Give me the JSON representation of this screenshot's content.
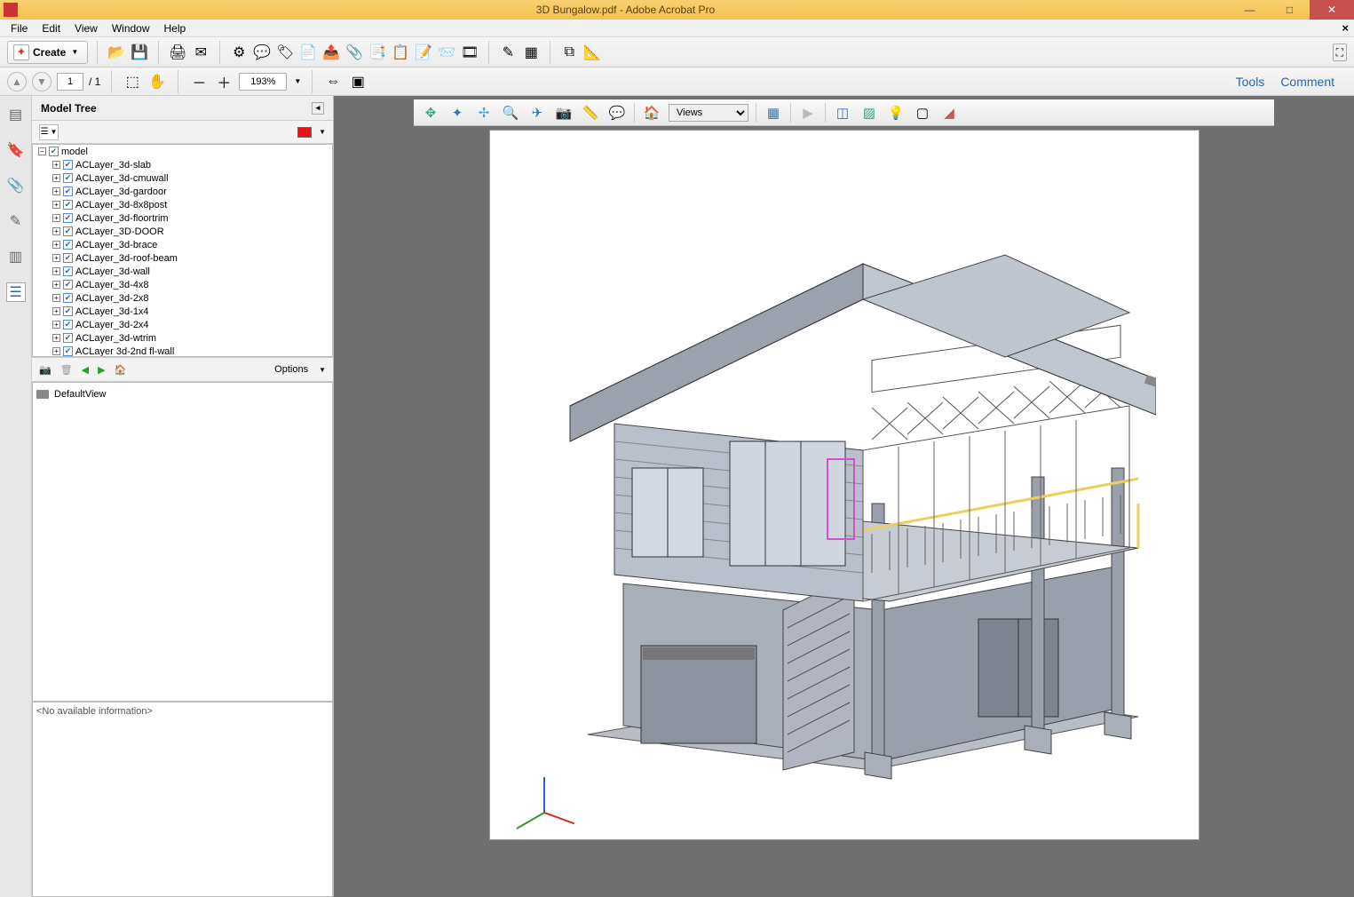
{
  "window": {
    "title": "3D Bungalow.pdf - Adobe Acrobat Pro"
  },
  "menubar": {
    "items": [
      "File",
      "Edit",
      "View",
      "Window",
      "Help"
    ]
  },
  "main_toolbar": {
    "create_label": "Create"
  },
  "nav": {
    "page_current": "1",
    "page_total": "/ 1",
    "zoom": "193%",
    "tools_label": "Tools",
    "comment_label": "Comment"
  },
  "panel": {
    "title": "Model Tree",
    "options_label": "Options",
    "info_placeholder": "<No available information>",
    "default_view_label": "DefaultView"
  },
  "tree": {
    "root": "model",
    "items": [
      "ACLayer_3d-slab",
      "ACLayer_3d-cmuwall",
      "ACLayer_3d-gardoor",
      "ACLayer_3d-8x8post",
      "ACLayer_3d-floortrim",
      "ACLayer_3D-DOOR",
      "ACLayer_3d-brace",
      "ACLayer_3d-roof-beam",
      "ACLayer_3d-wall",
      "ACLayer_3d-4x8",
      "ACLayer_3d-2x8",
      "ACLayer_3d-1x4",
      "ACLayer_3d-2x4",
      "ACLayer_3d-wtrim",
      "ACLayer 3d-2nd fl-wall"
    ]
  },
  "viewer": {
    "views_label": "Views"
  }
}
